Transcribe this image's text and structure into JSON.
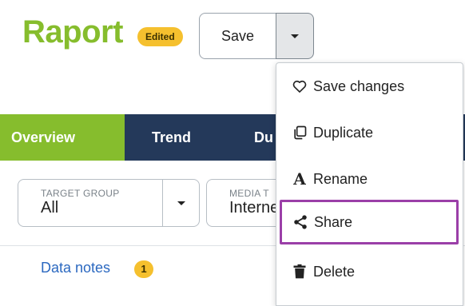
{
  "header": {
    "title": "Raport",
    "status_badge": "Edited",
    "save_label": "Save"
  },
  "tabs": [
    {
      "label": "Overview",
      "active": true
    },
    {
      "label": "Trend",
      "active": false
    },
    {
      "label": "Du",
      "active": false
    }
  ],
  "filters": {
    "target_group": {
      "label": "TARGET GROUP",
      "value": "All"
    },
    "media_type": {
      "label": "MEDIA T",
      "value": "Interne"
    }
  },
  "data_notes": {
    "label": "Data notes",
    "count": "1"
  },
  "menu": {
    "items": [
      {
        "label": "Save changes",
        "icon": "heart-icon"
      },
      {
        "label": "Duplicate",
        "icon": "duplicate-icon"
      },
      {
        "label": "Rename",
        "icon": "rename-icon"
      },
      {
        "label": "Share",
        "icon": "share-icon",
        "highlighted": true
      },
      {
        "label": "Delete",
        "icon": "trash-icon"
      }
    ]
  },
  "colors": {
    "brand_green": "#86bd2d",
    "nav_navy": "#24395a",
    "badge_yellow": "#f5c02e",
    "link_blue": "#2b68c0",
    "highlight_purple": "#9b3fa8"
  }
}
